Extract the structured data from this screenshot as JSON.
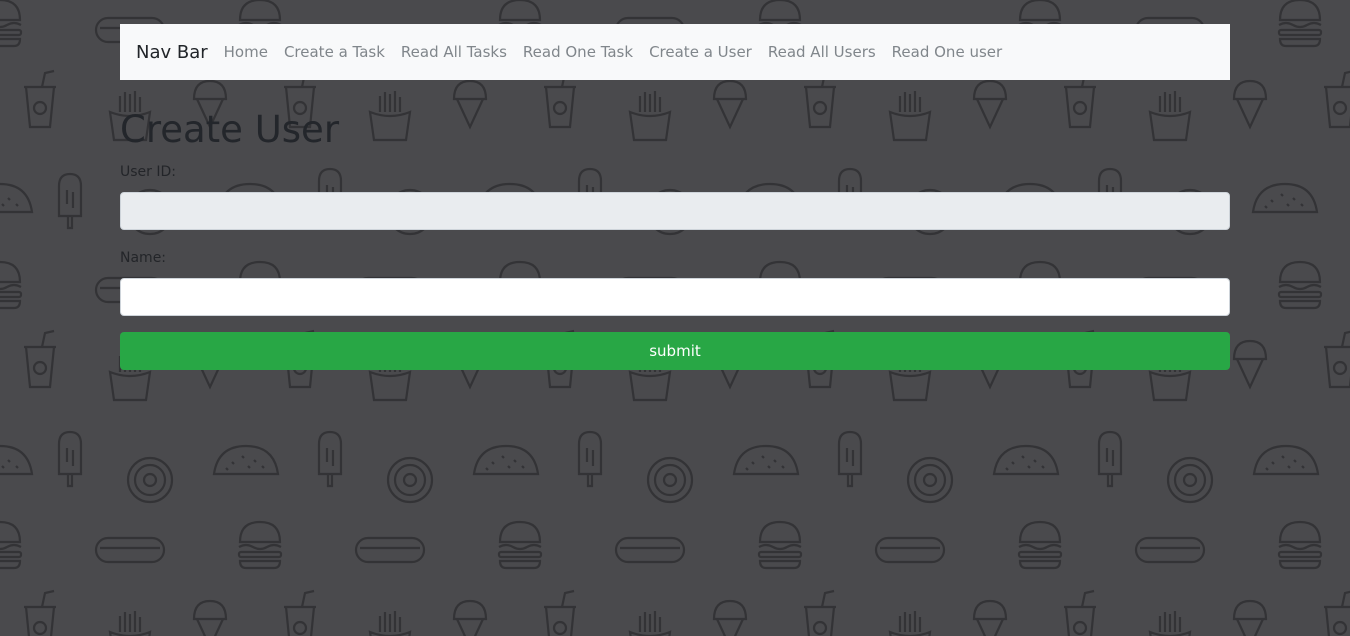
{
  "navbar": {
    "brand": "Nav Bar",
    "links": [
      "Home",
      "Create a Task",
      "Read All Tasks",
      "Read One Task",
      "Create a User",
      "Read All Users",
      "Read One user"
    ]
  },
  "page": {
    "title": "Create User"
  },
  "form": {
    "user_id_label": "User ID:",
    "user_id_value": "",
    "name_label": "Name:",
    "name_value": "",
    "submit_label": "submit"
  },
  "colors": {
    "background": "#4a4a4d",
    "pattern_stroke": "#333336",
    "navbar_bg": "#f8f9fa",
    "submit_bg": "#28a745",
    "readonly_field_bg": "#e9ecef"
  },
  "background_pattern_icons": [
    "burger-icon",
    "soda-cup-icon",
    "fries-icon",
    "ice-cream-cone-icon",
    "popsicle-icon",
    "taco-icon",
    "donut-icon",
    "hotdog-icon"
  ]
}
